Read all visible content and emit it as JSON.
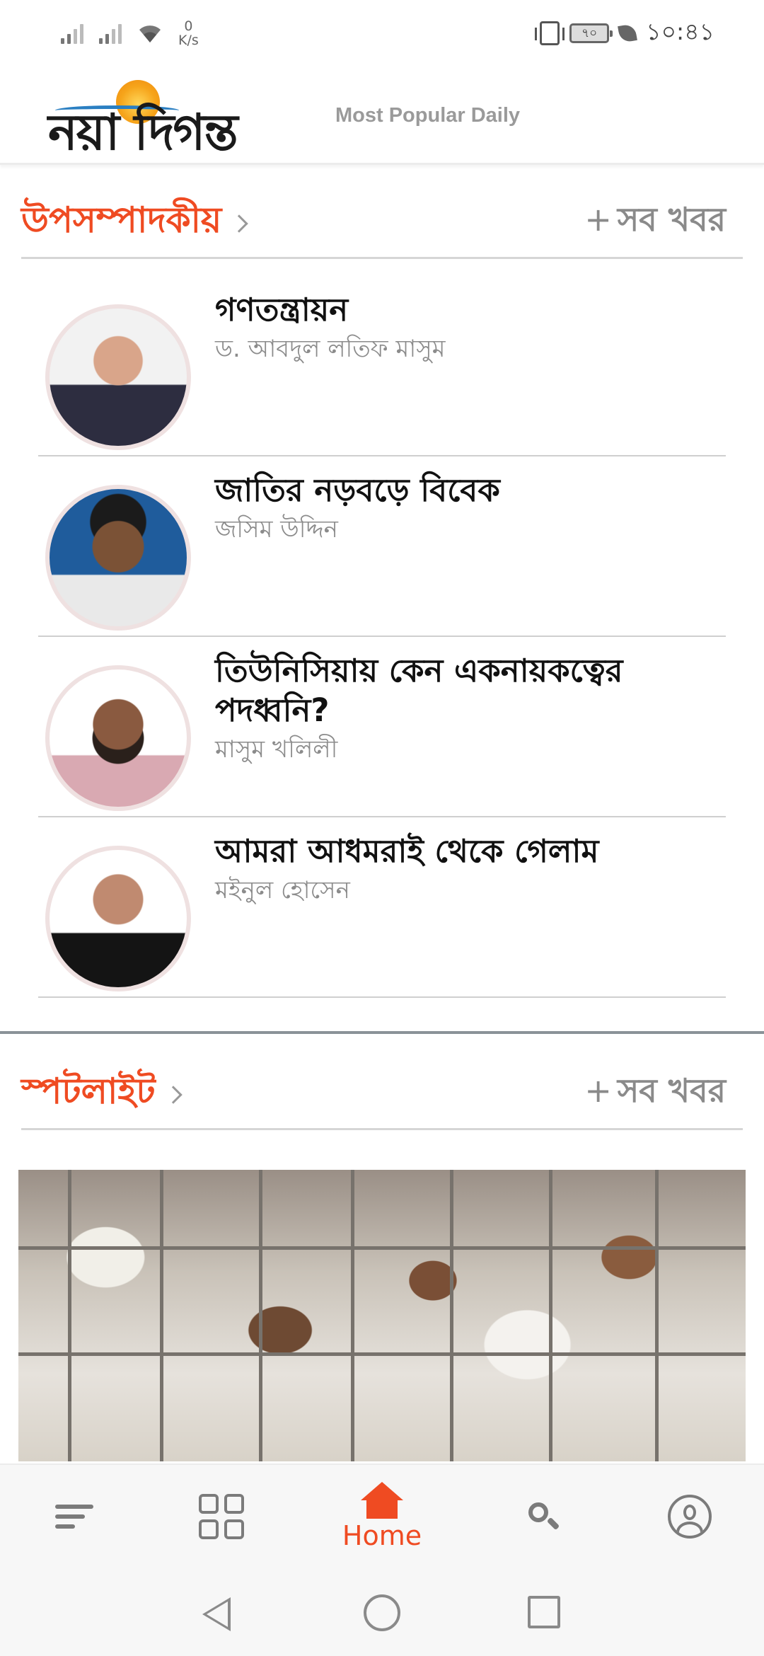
{
  "status_bar": {
    "net_speed_value": "0",
    "net_speed_unit": "K/s",
    "battery_level": "৭০",
    "time": "১০:৪১"
  },
  "app": {
    "logo_text": "নয়া দিগন্ত",
    "tagline": "Most Popular Daily"
  },
  "editorial_section": {
    "title": "উপসম্পাদকীয়",
    "more_plus": "+",
    "more_label": "সব খবর",
    "items": [
      {
        "title": "গণতন্ত্রায়ন",
        "author": "ড. আবদুল লতিফ মাসুম"
      },
      {
        "title": "জাতির নড়বড়ে বিবেক",
        "author": "জসিম উদ্দিন"
      },
      {
        "title": "তিউনিসিয়ায় কেন একনায়কত্বের পদধ্বনি?",
        "author": "মাসুম খলিলী"
      },
      {
        "title": "আমরা আধমরাই থেকে গেলাম",
        "author": "মইনুল হোসেন"
      }
    ]
  },
  "spotlight_section": {
    "title": "স্পটলাইট",
    "more_plus": "+",
    "more_label": "সব খবর"
  },
  "bottom_nav": {
    "home_label": "Home",
    "active": "home"
  },
  "colors": {
    "accent": "#ef4b22",
    "muted_text": "#8b8b8b",
    "icon_gray": "#7b7b7b"
  }
}
